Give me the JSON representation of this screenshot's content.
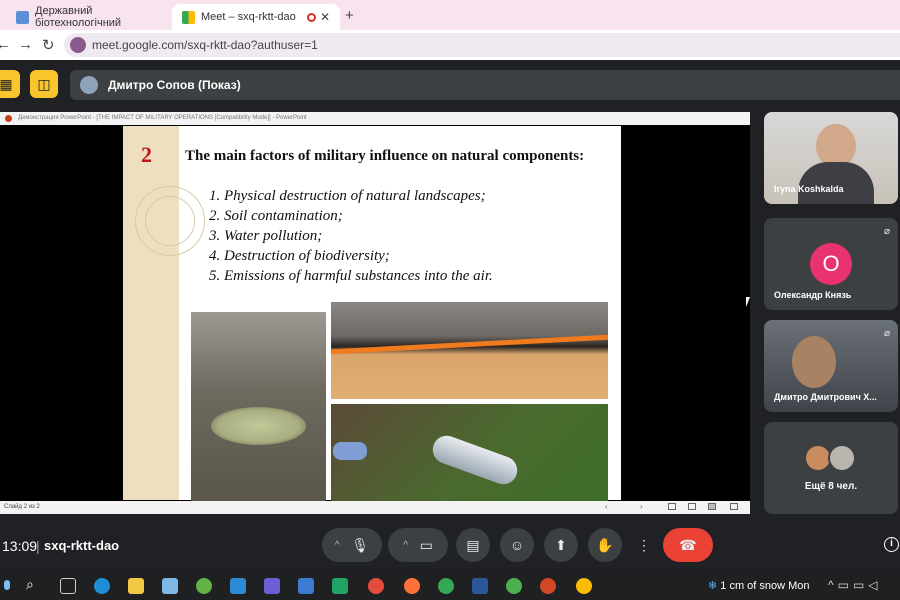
{
  "browser": {
    "tabs": [
      {
        "title": "Державний біотехнологічний"
      },
      {
        "title": "Meet – sxq-rktt-dao"
      }
    ],
    "new_tab": "+",
    "url": "meet.google.com/sxq-rktt-dao?authuser=1"
  },
  "meet": {
    "presenter_label": "Дмитро Сопов (Показ)",
    "ppt_window_title": "Демонстрация PowerPoint - [THE IMPACT OF MILITARY OPERATIONS [Compatibility Mode]] - PowerPoint",
    "ppt_status": "Слайд 2 из 2",
    "slide": {
      "number": "2",
      "title": "The main factors of military influence on natural components:",
      "items": [
        "1. Physical destruction of natural landscapes;",
        "2. Soil contamination;",
        "3. Water pollution;",
        "4. Destruction of biodiversity;",
        "5. Emissions of harmful substances into the air."
      ]
    },
    "participants": [
      {
        "name": "Iryna Koshkalda",
        "muted": false
      },
      {
        "name": "Олександр Князь",
        "initial": "О",
        "muted": true
      },
      {
        "name": "Дмитро Дмитрович Х...",
        "muted": true
      }
    ],
    "more_participants": "Ещё 8 чел.",
    "time": "13:09",
    "meeting_code": "sxq-rktt-dao",
    "colors": {
      "end_call": "#ea4335",
      "avatar": "#e8336e",
      "action": "#f8c52c"
    }
  },
  "taskbar": {
    "weather": "1 cm of snow Mon"
  }
}
